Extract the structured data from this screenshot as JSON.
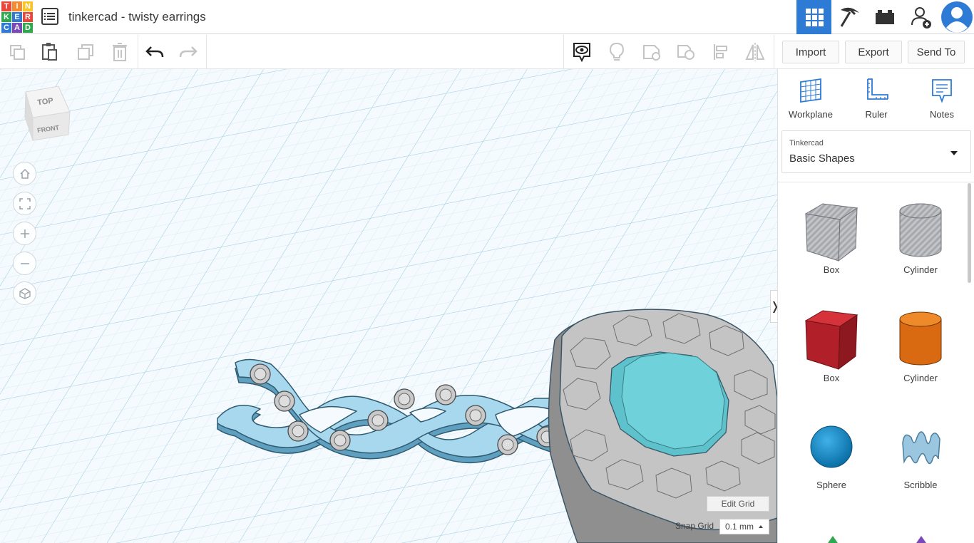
{
  "app": {
    "title": "tinkercad - twisty earrings",
    "logo_letters": [
      "T",
      "I",
      "N",
      "K",
      "E",
      "R",
      "C",
      "A",
      "D"
    ],
    "colors": {
      "accent": "#2e7bd6",
      "logo": [
        "#e8483b",
        "#f58a2f",
        "#f7c52b",
        "#2fa84f",
        "#2e7bd6",
        "#7a48b8",
        "#e8483b",
        "#2fa84f",
        "#2e7bd6"
      ]
    }
  },
  "header": {
    "menu_icon": "list-icon",
    "icons": [
      "3d-design-grid-icon",
      "pickaxe-icon",
      "bricks-icon",
      "add-user-icon",
      "avatar-icon"
    ]
  },
  "toolbar": {
    "left_icons": [
      "copy-icon",
      "paste-icon",
      "duplicate-icon",
      "delete-icon",
      "undo-icon",
      "redo-icon"
    ],
    "right_icons": [
      "notes-visibility-icon",
      "lightbulb-icon",
      "group-icon",
      "ungroup-icon",
      "align-icon",
      "mirror-icon"
    ],
    "import_label": "Import",
    "export_label": "Export",
    "send_to_label": "Send To"
  },
  "workspace": {
    "viewcube": {
      "top": "TOP",
      "front": "FRONT"
    },
    "nav_icons": [
      "home-icon",
      "fit-view-icon",
      "zoom-in-icon",
      "zoom-out-icon",
      "perspective-icon"
    ],
    "edit_grid_label": "Edit Grid",
    "snap_grid_label": "Snap Grid",
    "snap_grid_value": "0.1 mm"
  },
  "panel": {
    "tools": [
      {
        "label": "Workplane",
        "icon": "workplane-icon"
      },
      {
        "label": "Ruler",
        "icon": "ruler-icon"
      },
      {
        "label": "Notes",
        "icon": "notes-icon"
      }
    ],
    "library_source": "Tinkercad",
    "library_name": "Basic Shapes",
    "shapes": [
      {
        "label": "Box",
        "kind": "hole-box"
      },
      {
        "label": "Cylinder",
        "kind": "hole-cylinder"
      },
      {
        "label": "Box",
        "kind": "box"
      },
      {
        "label": "Cylinder",
        "kind": "cylinder"
      },
      {
        "label": "Sphere",
        "kind": "sphere"
      },
      {
        "label": "Scribble",
        "kind": "scribble"
      }
    ]
  }
}
